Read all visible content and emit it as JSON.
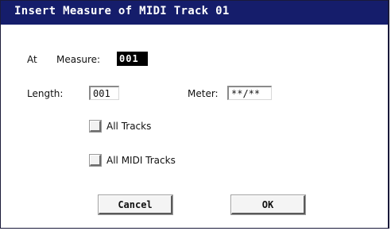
{
  "dialog": {
    "title": "Insert Measure of MIDI Track 01"
  },
  "at": {
    "label": "At",
    "measure_label": "Measure:",
    "measure_value": "001"
  },
  "length": {
    "label": "Length:",
    "value": "001"
  },
  "meter": {
    "label": "Meter:",
    "value": "**/**"
  },
  "options": {
    "all_tracks": {
      "label": "All Tracks",
      "checked": false
    },
    "all_midi_tracks": {
      "label": "All MIDI Tracks",
      "checked": false
    }
  },
  "buttons": {
    "cancel": "Cancel",
    "ok": "OK"
  },
  "colors": {
    "titlebar": "#151d6b",
    "selected_field": "#000000"
  }
}
